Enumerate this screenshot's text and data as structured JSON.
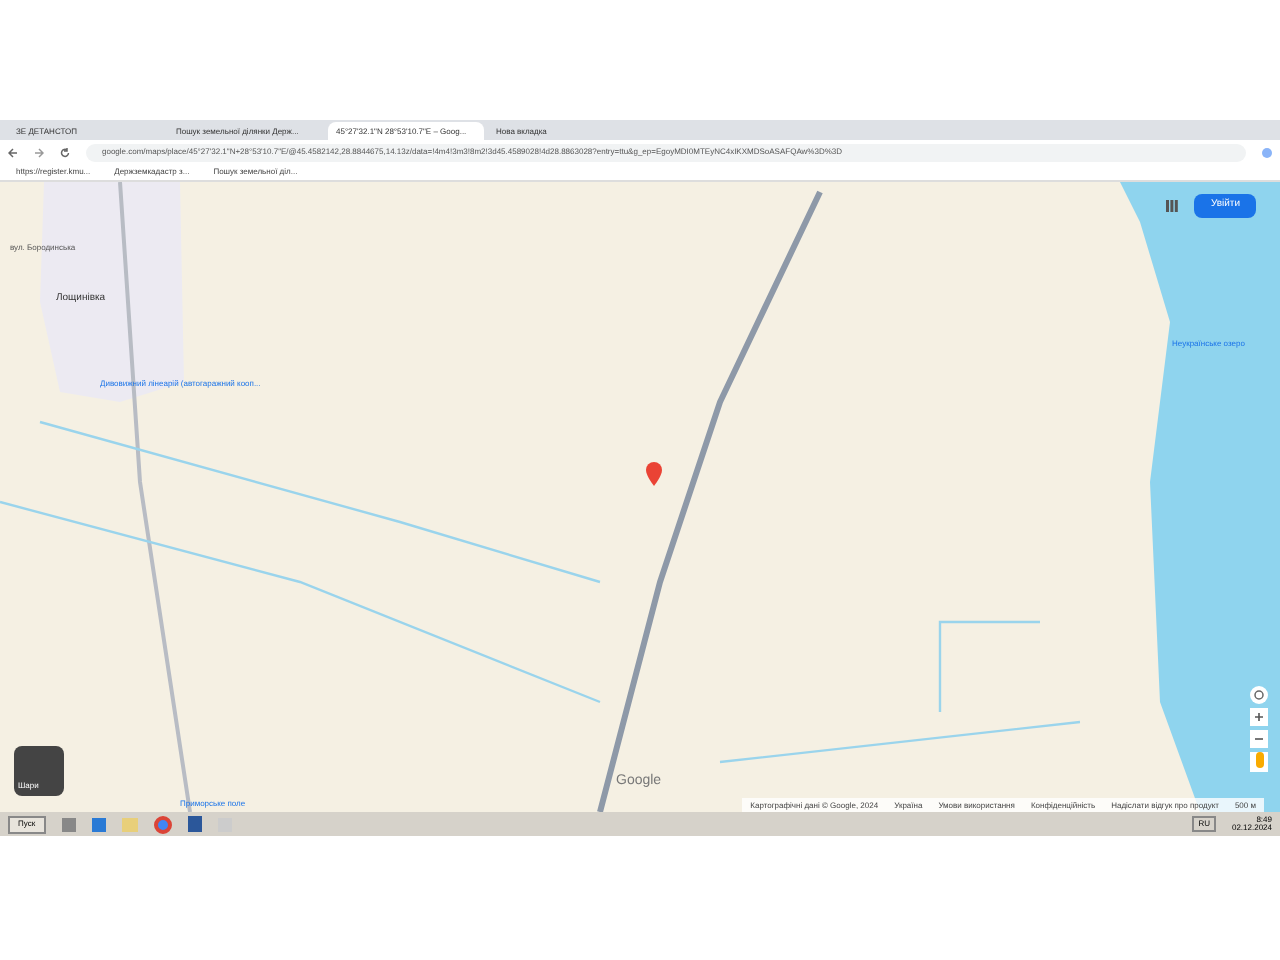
{
  "tabs": [
    {
      "title": "ЗЕ ДЕТАНСТОП",
      "selected": false
    },
    {
      "title": "Пошук земельної ділянки Держ...",
      "selected": false
    },
    {
      "title": "45°27'32.1\"N 28°53'10.7\"E – Goog...",
      "selected": true
    },
    {
      "title": "Нова вкладка",
      "selected": false
    }
  ],
  "address": "google.com/maps/place/45°27'32.1\"N+28°53'10.7\"E/@45.4582142,28.8844675,14.13z/data=!4m4!3m3!8m2!3d45.4589028!4d28.8863028?entry=ttu&g_ep=EgoyMDI0MTEyNC4xIKXMDSoASAFQAw%3D%3D",
  "bookmarks": [
    "https://register.kmu...",
    "Держземкадастр з...",
    "Пошук земельної діл..."
  ],
  "map": {
    "labels": [
      {
        "text": "Лощинівка",
        "kind": "town"
      },
      {
        "text": "вул. Бородинська",
        "kind": "street"
      },
      {
        "text": "Дивовижний лінеарій (автогаражний кооп...",
        "kind": "poi"
      },
      {
        "text": "Неукраїнське озеро",
        "kind": "poi"
      },
      {
        "text": "Приморське поле",
        "kind": "poi"
      }
    ],
    "sign_in": "Увійти",
    "layers": "Шари",
    "logo": "Google",
    "footer": [
      "Картографічні дані © Google, 2024",
      "Україна",
      "Умови використання",
      "Конфіденційність",
      "Надіслати відгук про продукт",
      "500 м"
    ]
  },
  "taskbar": {
    "start": "Пуск",
    "lang": "RU",
    "time": "8:49",
    "date": "02.12.2024"
  }
}
